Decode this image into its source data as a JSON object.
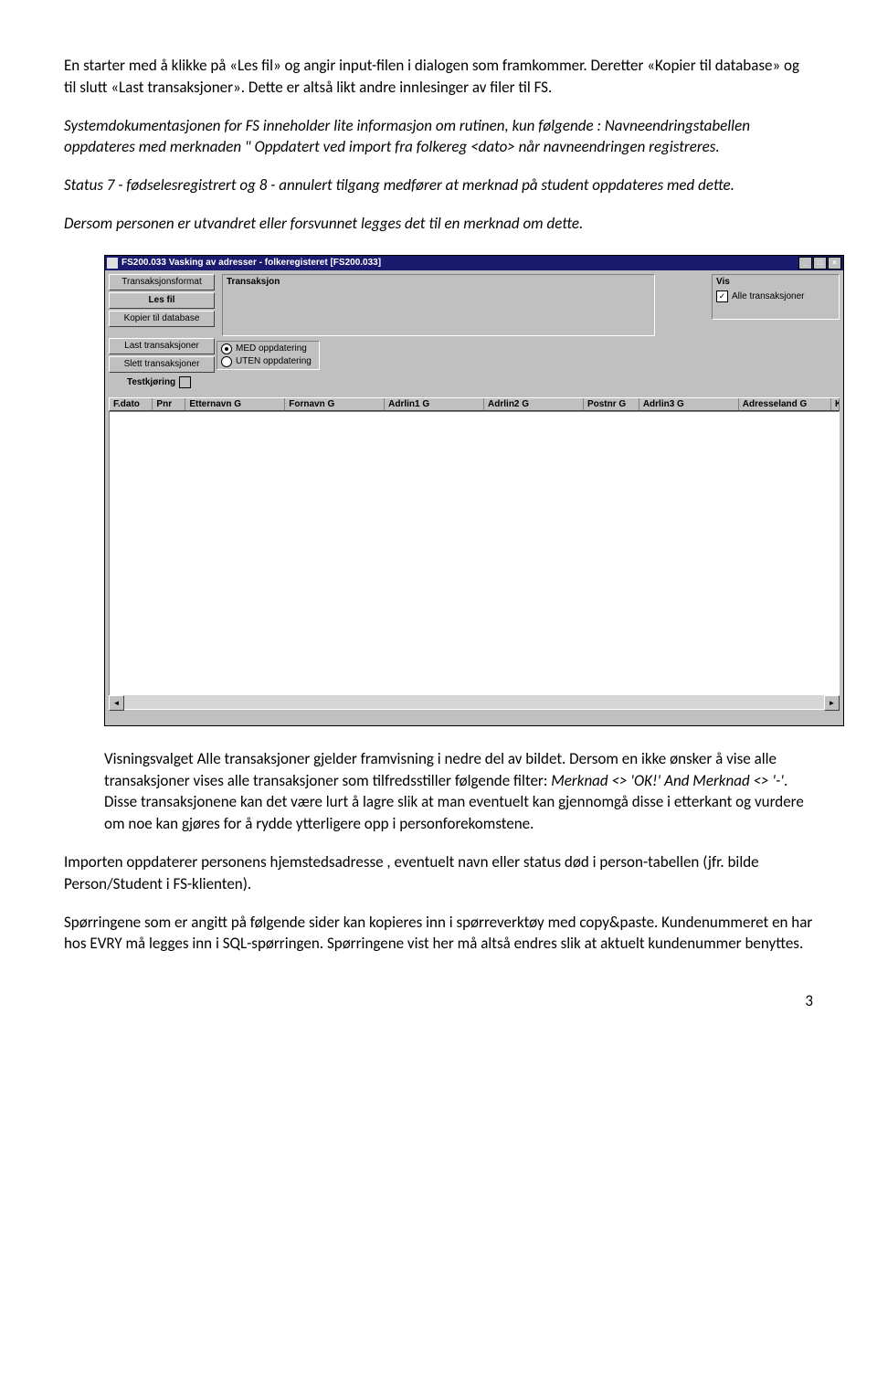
{
  "para1": "En starter med å klikke på «Les fil» og angir input-filen i dialogen som framkommer. Deretter «Kopier til database» og til slutt «Last transaksjoner». Dette er altså likt andre innlesinger av filer til FS.",
  "para2": "Systemdokumentasjonen for FS inneholder lite informasjon om rutinen, kun følgende : Navneendringstabellen oppdateres med merknaden \" Oppdatert ved import fra folkereg <dato> når navneendringen registreres.",
  "para3": "Status 7 - fødselesregistrert og 8 - annulert tilgang medfører at merknad på student oppdateres med dette.",
  "para4": "Dersom personen er utvandret eller forsvunnet legges det til en merknad om dette.",
  "window": {
    "title": "FS200.033 Vasking av adresser - folkeregisteret  [FS200.033]",
    "buttons": {
      "transFormat": "Transaksjonsformat",
      "lesFil": "Les fil",
      "kopier": "Kopier til database",
      "last": "Last transaksjoner",
      "slett": "Slett transaksjoner"
    },
    "transLabel": "Transaksjon",
    "visLabel": "Vis",
    "visCheck": "Alle transaksjoner",
    "opt1": "MED oppdatering",
    "opt2": "UTEN oppdatering",
    "testLabel": "Testkjøring",
    "cols": {
      "fdato": "F.dato",
      "pnr": "Pnr",
      "etternavn": "Etternavn G",
      "fornavn": "Fornavn G",
      "adrlin1": "Adrlin1 G",
      "adrlin2": "Adrlin2 G",
      "postnr": "Postnr G",
      "adrlin3": "Adrlin3 G",
      "adrland": "Adresseland G",
      "kd": "Kd"
    }
  },
  "para5a": "Visningsvalget Alle transaksjoner gjelder framvisning i nedre del av bildet. Dersom en ikke ønsker å vise alle transaksjoner vises alle transaksjoner som tilfredsstiller følgende filter: ",
  "para5b": "Merknad <> 'OK!' And Merknad <> '-'",
  "para5c": ". Disse transaksjonene kan det være lurt å lagre slik at man eventuelt kan gjennomgå disse i etterkant og vurdere om noe kan gjøres for å rydde ytterligere opp i personforekomstene.",
  "para6": "Importen oppdaterer personens hjemstedsadresse , eventuelt navn eller status død i person-tabellen (jfr. bilde Person/Student i FS-klienten).",
  "para7": "Spørringene som er angitt på følgende sider kan kopieres inn i spørreverktøy med copy&paste. Kundenummeret en har hos EVRY må legges inn i SQL-spørringen. Spørringene vist her må altså endres slik at aktuelt kundenummer benyttes.",
  "pageNum": "3"
}
